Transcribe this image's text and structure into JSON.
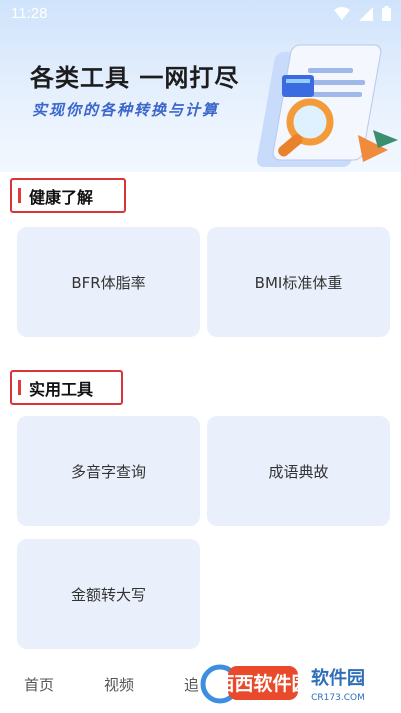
{
  "status_bar": {
    "time": "11:28"
  },
  "hero": {
    "title": "各类工具 一网打尽",
    "subtitle": "实现你的各种转换与计算"
  },
  "sections": [
    {
      "title": "健康了解",
      "items": [
        "BFR体脂率",
        "BMI标准体重"
      ]
    },
    {
      "title": "实用工具",
      "items": [
        "多音字查询",
        "成语典故",
        "金额转大写"
      ]
    }
  ],
  "bottom_nav": {
    "items": [
      "首页",
      "视频",
      "追"
    ]
  },
  "watermark": {
    "text": "西西软件园",
    "sub": "CR173.COM"
  },
  "colors": {
    "accent_red": "#d8353a",
    "card_bg": "#e9f0fb",
    "subtitle_blue": "#3a67c9"
  }
}
